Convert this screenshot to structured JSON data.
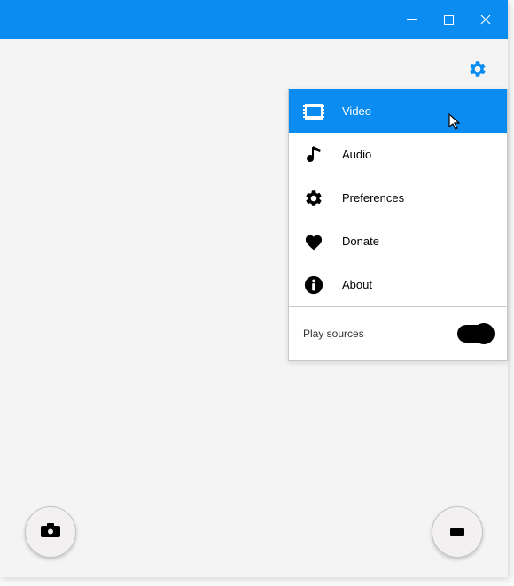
{
  "menu": {
    "items": [
      {
        "label": "Video"
      },
      {
        "label": "Audio"
      },
      {
        "label": "Preferences"
      },
      {
        "label": "Donate"
      },
      {
        "label": "About"
      }
    ],
    "toggle_label": "Play sources"
  },
  "colors": {
    "accent": "#0a8cf0"
  }
}
